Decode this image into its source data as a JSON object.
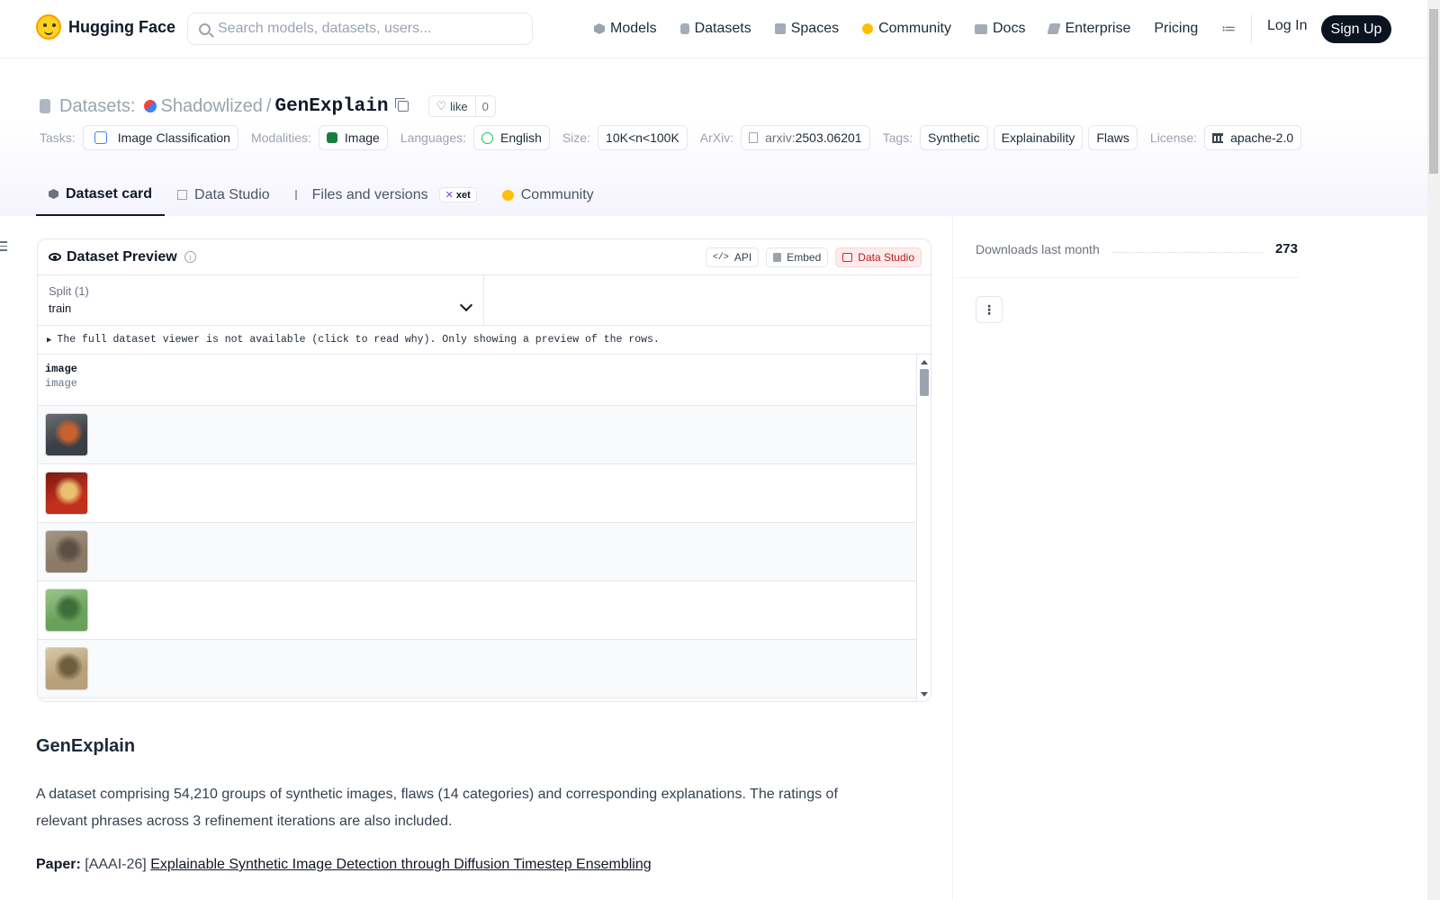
{
  "nav": {
    "brand": "Hugging Face",
    "search_placeholder": "Search models, datasets, users...",
    "links": [
      {
        "label": "Models",
        "icon": "model-icon"
      },
      {
        "label": "Datasets",
        "icon": "dataset-icon"
      },
      {
        "label": "Spaces",
        "icon": "spaces-icon"
      },
      {
        "label": "Community",
        "icon": "community-icon"
      },
      {
        "label": "Docs",
        "icon": "docs-icon"
      },
      {
        "label": "Enterprise",
        "icon": "enterprise-icon"
      },
      {
        "label": "Pricing"
      }
    ],
    "menu_icon": "≔",
    "login": "Log In",
    "signup": "Sign Up"
  },
  "header": {
    "section": "Datasets:",
    "owner": "Shadowlized",
    "slash": "/",
    "repo": "GenExplain",
    "like_label": "like",
    "like_count": "0"
  },
  "meta": {
    "tasks_label": "Tasks:",
    "task": "Image Classification",
    "modalities_label": "Modalities:",
    "modality": "Image",
    "languages_label": "Languages:",
    "language": "English",
    "size_label": "Size:",
    "size": "10K<n<100K",
    "arxiv_label": "ArXiv:",
    "arxiv_prefix": "arxiv:",
    "arxiv_id": "2503.06201",
    "tags_label": "Tags:",
    "tags": [
      "Synthetic",
      "Explainability",
      "Flaws"
    ],
    "license_label": "License:",
    "license": "apache-2.0"
  },
  "tabs": {
    "dataset_card": "Dataset card",
    "data_studio": "Data Studio",
    "files": "Files and versions",
    "xet": "xet",
    "community": "Community"
  },
  "preview": {
    "title": "Dataset Preview",
    "info": "i",
    "api": "API",
    "embed": "Embed",
    "studio": "Data Studio",
    "split_label": "Split (1)",
    "split_value": "train",
    "notice": "The full dataset viewer is not available (click to read why). Only showing a preview of the rows.",
    "column": {
      "name": "image",
      "type": "image"
    },
    "rows": [
      {
        "thumb": "thumb-cooked-lobster",
        "colors": [
          "#3a3f45",
          "#c8612e",
          "#6b6f73"
        ]
      },
      {
        "thumb": "thumb-crawfish-plate",
        "colors": [
          "#c0301c",
          "#e9c070",
          "#7a1a10"
        ]
      },
      {
        "thumb": "thumb-insect-on-ground",
        "colors": [
          "#8a7a66",
          "#5c5044",
          "#a39682"
        ]
      },
      {
        "thumb": "thumb-blue-heron",
        "colors": [
          "#6aa25a",
          "#3e6e3a",
          "#9cc58c"
        ]
      },
      {
        "thumb": "thumb-bittern-reeds",
        "colors": [
          "#b8a07a",
          "#6e5e3e",
          "#d8c8a8"
        ]
      }
    ]
  },
  "readme": {
    "title": "GenExplain",
    "description": "A dataset comprising 54,210 groups of synthetic images, flaws (14 categories) and corresponding explanations. The ratings of relevant phrases across 3 refinement iterations are also included.",
    "paper_label": "Paper:",
    "paper_venue": "[AAAI-26]",
    "paper_title": "Explainable Synthetic Image Detection through Diffusion Timestep Ensembling"
  },
  "sidebar": {
    "downloads_label": "Downloads last month",
    "downloads_value": "273",
    "more": "⋮"
  }
}
